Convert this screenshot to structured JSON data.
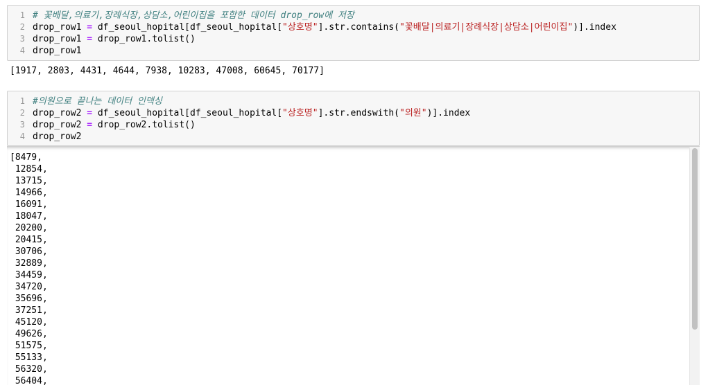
{
  "cell1": {
    "lines": [
      {
        "num": "1",
        "parts": [
          {
            "t": "# 꽃배달,의료기,장례식장,상담소,어린이집을 포함한 데이터 drop_row에 저장",
            "c": "cm"
          }
        ]
      },
      {
        "num": "2",
        "parts": [
          {
            "t": "drop_row1 ",
            "c": "code"
          },
          {
            "t": "=",
            "c": "op"
          },
          {
            "t": " df_seoul_hopital[df_seoul_hopital[",
            "c": "code"
          },
          {
            "t": "\"상호명\"",
            "c": "str"
          },
          {
            "t": "].str.contains(",
            "c": "code"
          },
          {
            "t": "\"꽃배달|의료기|장례식장|상담소|어린이집\"",
            "c": "str"
          },
          {
            "t": ")].index",
            "c": "code"
          }
        ]
      },
      {
        "num": "3",
        "parts": [
          {
            "t": "drop_row1 ",
            "c": "code"
          },
          {
            "t": "=",
            "c": "op"
          },
          {
            "t": " drop_row1.tolist()",
            "c": "code"
          }
        ]
      },
      {
        "num": "4",
        "parts": [
          {
            "t": "drop_row1",
            "c": "code"
          }
        ]
      }
    ],
    "output": "[1917, 2803, 4431, 4644, 7938, 10283, 47008, 60645, 70177]"
  },
  "cell2": {
    "lines": [
      {
        "num": "1",
        "parts": [
          {
            "t": "#의원으로 끝나는 데이터 인덱싱",
            "c": "cm"
          }
        ]
      },
      {
        "num": "2",
        "parts": [
          {
            "t": "drop_row2 ",
            "c": "code"
          },
          {
            "t": "=",
            "c": "op"
          },
          {
            "t": " df_seoul_hopital[df_seoul_hopital[",
            "c": "code"
          },
          {
            "t": "\"상호명\"",
            "c": "str"
          },
          {
            "t": "].str.endswith(",
            "c": "code"
          },
          {
            "t": "\"의원\"",
            "c": "str"
          },
          {
            "t": ")].index",
            "c": "code"
          }
        ]
      },
      {
        "num": "3",
        "parts": [
          {
            "t": "drop_row2 ",
            "c": "code"
          },
          {
            "t": "=",
            "c": "op"
          },
          {
            "t": " drop_row2.tolist()",
            "c": "code"
          }
        ]
      },
      {
        "num": "4",
        "parts": [
          {
            "t": "drop_row2",
            "c": "code"
          }
        ]
      }
    ],
    "output_lines": [
      "[8479,",
      " 12854,",
      " 13715,",
      " 14966,",
      " 16091,",
      " 18047,",
      " 20200,",
      " 20415,",
      " 30706,",
      " 32889,",
      " 34459,",
      " 34720,",
      " 35696,",
      " 37251,",
      " 45120,",
      " 49626,",
      " 51575,",
      " 55133,",
      " 56320,",
      " 56404,"
    ]
  }
}
